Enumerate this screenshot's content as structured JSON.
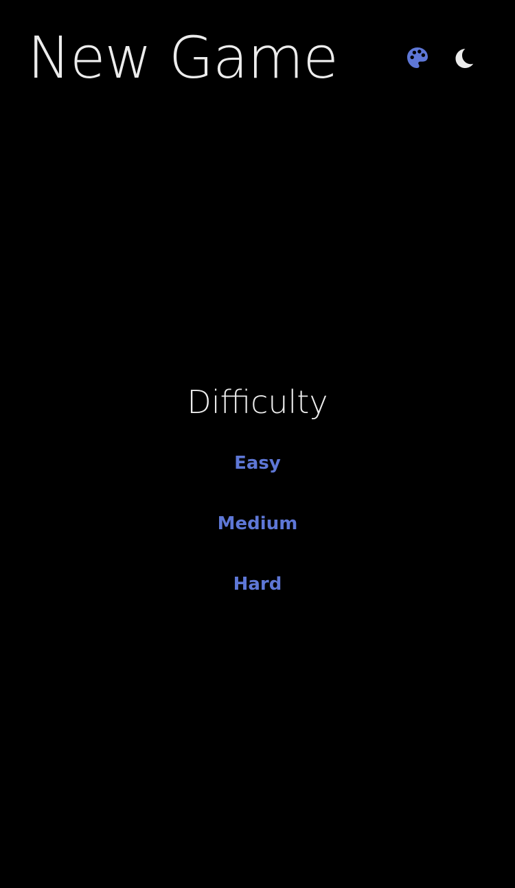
{
  "header": {
    "title": "New Game",
    "palette_icon": "palette-icon",
    "theme_icon": "moon-icon"
  },
  "difficulty": {
    "heading": "Difficulty",
    "options": [
      {
        "label": "Easy"
      },
      {
        "label": "Medium"
      },
      {
        "label": "Hard"
      }
    ]
  },
  "colors": {
    "background": "#000000",
    "text": "#ececec",
    "accent": "#5e77d6"
  }
}
